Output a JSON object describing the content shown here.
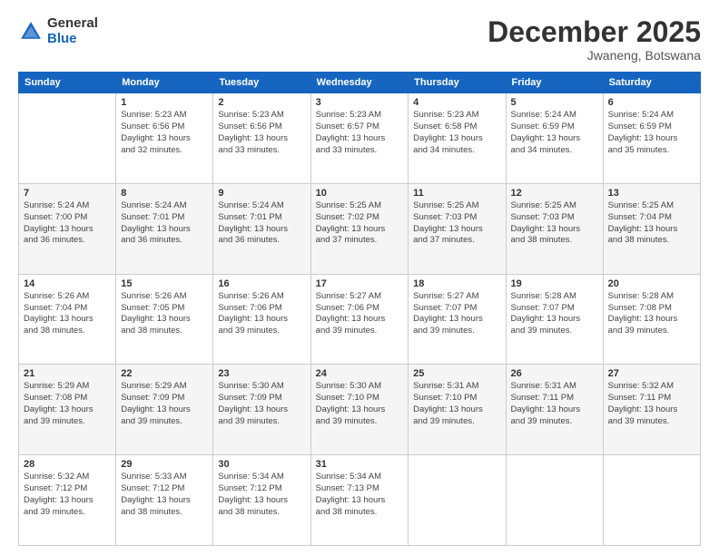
{
  "header": {
    "logo_general": "General",
    "logo_blue": "Blue",
    "month_title": "December 2025",
    "location": "Jwaneng, Botswana"
  },
  "days_of_week": [
    "Sunday",
    "Monday",
    "Tuesday",
    "Wednesday",
    "Thursday",
    "Friday",
    "Saturday"
  ],
  "weeks": [
    [
      {
        "day": "",
        "info": ""
      },
      {
        "day": "1",
        "info": "Sunrise: 5:23 AM\nSunset: 6:56 PM\nDaylight: 13 hours\nand 32 minutes."
      },
      {
        "day": "2",
        "info": "Sunrise: 5:23 AM\nSunset: 6:56 PM\nDaylight: 13 hours\nand 33 minutes."
      },
      {
        "day": "3",
        "info": "Sunrise: 5:23 AM\nSunset: 6:57 PM\nDaylight: 13 hours\nand 33 minutes."
      },
      {
        "day": "4",
        "info": "Sunrise: 5:23 AM\nSunset: 6:58 PM\nDaylight: 13 hours\nand 34 minutes."
      },
      {
        "day": "5",
        "info": "Sunrise: 5:24 AM\nSunset: 6:59 PM\nDaylight: 13 hours\nand 34 minutes."
      },
      {
        "day": "6",
        "info": "Sunrise: 5:24 AM\nSunset: 6:59 PM\nDaylight: 13 hours\nand 35 minutes."
      }
    ],
    [
      {
        "day": "7",
        "info": "Sunrise: 5:24 AM\nSunset: 7:00 PM\nDaylight: 13 hours\nand 36 minutes."
      },
      {
        "day": "8",
        "info": "Sunrise: 5:24 AM\nSunset: 7:01 PM\nDaylight: 13 hours\nand 36 minutes."
      },
      {
        "day": "9",
        "info": "Sunrise: 5:24 AM\nSunset: 7:01 PM\nDaylight: 13 hours\nand 36 minutes."
      },
      {
        "day": "10",
        "info": "Sunrise: 5:25 AM\nSunset: 7:02 PM\nDaylight: 13 hours\nand 37 minutes."
      },
      {
        "day": "11",
        "info": "Sunrise: 5:25 AM\nSunset: 7:03 PM\nDaylight: 13 hours\nand 37 minutes."
      },
      {
        "day": "12",
        "info": "Sunrise: 5:25 AM\nSunset: 7:03 PM\nDaylight: 13 hours\nand 38 minutes."
      },
      {
        "day": "13",
        "info": "Sunrise: 5:25 AM\nSunset: 7:04 PM\nDaylight: 13 hours\nand 38 minutes."
      }
    ],
    [
      {
        "day": "14",
        "info": "Sunrise: 5:26 AM\nSunset: 7:04 PM\nDaylight: 13 hours\nand 38 minutes."
      },
      {
        "day": "15",
        "info": "Sunrise: 5:26 AM\nSunset: 7:05 PM\nDaylight: 13 hours\nand 38 minutes."
      },
      {
        "day": "16",
        "info": "Sunrise: 5:26 AM\nSunset: 7:06 PM\nDaylight: 13 hours\nand 39 minutes."
      },
      {
        "day": "17",
        "info": "Sunrise: 5:27 AM\nSunset: 7:06 PM\nDaylight: 13 hours\nand 39 minutes."
      },
      {
        "day": "18",
        "info": "Sunrise: 5:27 AM\nSunset: 7:07 PM\nDaylight: 13 hours\nand 39 minutes."
      },
      {
        "day": "19",
        "info": "Sunrise: 5:28 AM\nSunset: 7:07 PM\nDaylight: 13 hours\nand 39 minutes."
      },
      {
        "day": "20",
        "info": "Sunrise: 5:28 AM\nSunset: 7:08 PM\nDaylight: 13 hours\nand 39 minutes."
      }
    ],
    [
      {
        "day": "21",
        "info": "Sunrise: 5:29 AM\nSunset: 7:08 PM\nDaylight: 13 hours\nand 39 minutes."
      },
      {
        "day": "22",
        "info": "Sunrise: 5:29 AM\nSunset: 7:09 PM\nDaylight: 13 hours\nand 39 minutes."
      },
      {
        "day": "23",
        "info": "Sunrise: 5:30 AM\nSunset: 7:09 PM\nDaylight: 13 hours\nand 39 minutes."
      },
      {
        "day": "24",
        "info": "Sunrise: 5:30 AM\nSunset: 7:10 PM\nDaylight: 13 hours\nand 39 minutes."
      },
      {
        "day": "25",
        "info": "Sunrise: 5:31 AM\nSunset: 7:10 PM\nDaylight: 13 hours\nand 39 minutes."
      },
      {
        "day": "26",
        "info": "Sunrise: 5:31 AM\nSunset: 7:11 PM\nDaylight: 13 hours\nand 39 minutes."
      },
      {
        "day": "27",
        "info": "Sunrise: 5:32 AM\nSunset: 7:11 PM\nDaylight: 13 hours\nand 39 minutes."
      }
    ],
    [
      {
        "day": "28",
        "info": "Sunrise: 5:32 AM\nSunset: 7:12 PM\nDaylight: 13 hours\nand 39 minutes."
      },
      {
        "day": "29",
        "info": "Sunrise: 5:33 AM\nSunset: 7:12 PM\nDaylight: 13 hours\nand 38 minutes."
      },
      {
        "day": "30",
        "info": "Sunrise: 5:34 AM\nSunset: 7:12 PM\nDaylight: 13 hours\nand 38 minutes."
      },
      {
        "day": "31",
        "info": "Sunrise: 5:34 AM\nSunset: 7:13 PM\nDaylight: 13 hours\nand 38 minutes."
      },
      {
        "day": "",
        "info": ""
      },
      {
        "day": "",
        "info": ""
      },
      {
        "day": "",
        "info": ""
      }
    ]
  ]
}
